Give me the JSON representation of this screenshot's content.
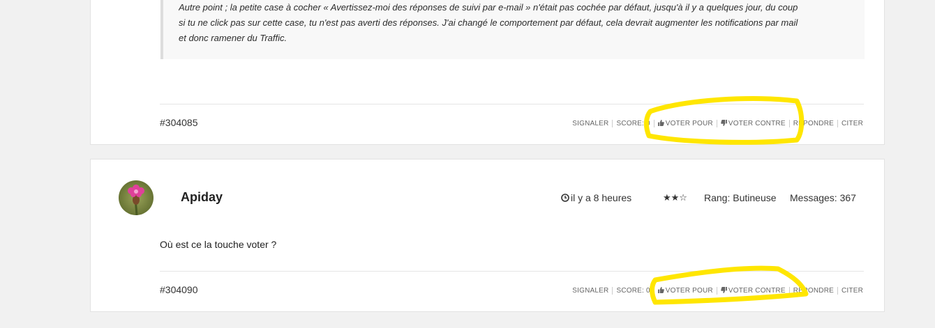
{
  "post1": {
    "quote_lines": [
      "Autre point ; la petite case à cocher « Avertissez-moi des réponses de suivi par e-mail » n'était pas cochée par défaut, jusqu'à il y a quelques jour, du coup",
      "si tu ne click pas sur cette case, tu n'est pas averti des réponses. J'ai changé le comportement par défaut, cela devrait augmenter les notifications par mail",
      "et donc ramener du Traffic."
    ],
    "id": "#304085",
    "actions": {
      "report": "SIGNALER",
      "score": "SCORE: 0",
      "vote_up": "VOTER POUR",
      "vote_down": "VOTER CONTRE",
      "reply": "RÉPONDRE",
      "quote": "CITER"
    }
  },
  "post2": {
    "username": "Apiday",
    "time": "il y a 8 heures",
    "stars": "★★☆",
    "rank": "Rang: Butineuse",
    "messages": "Messages: 367",
    "body": "Où est ce la touche voter  ?",
    "id": "#304090",
    "actions": {
      "report": "SIGNALER",
      "score": "SCORE: 0",
      "vote_up": "VOTER POUR",
      "vote_down": "VOTER CONTRE",
      "reply": "RÉPONDRE",
      "quote": "CITER"
    }
  },
  "colors": {
    "background": "#f1f1f1",
    "card": "#ffffff",
    "quote_bg": "#f8f8f8",
    "highlight": "#ffe600"
  },
  "icons": [
    "thumbs-up-icon",
    "thumbs-down-icon",
    "clock-icon",
    "star-icon",
    "avatar-flower"
  ]
}
